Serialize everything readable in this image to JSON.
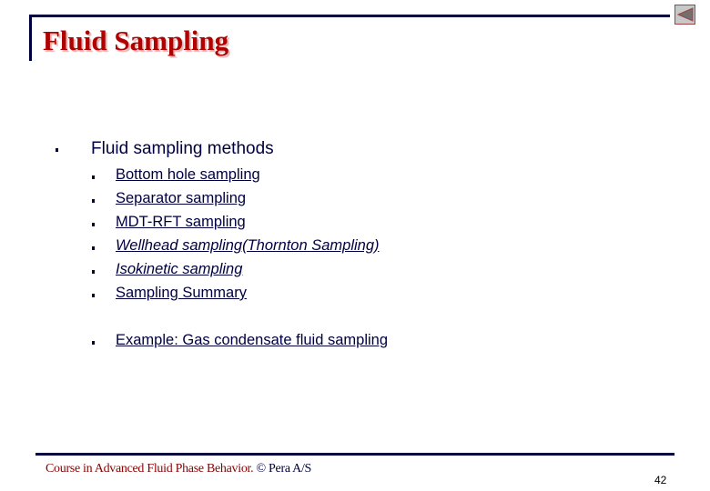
{
  "slide": {
    "title": "Fluid Sampling",
    "back_button_label": "previous-slide",
    "main_bullet": "Fluid sampling methods",
    "sub_items": [
      {
        "label": "Bottom hole sampling",
        "italic": false
      },
      {
        "label": "Separator sampling",
        "italic": false
      },
      {
        "label": "MDT-RFT sampling",
        "italic": false
      },
      {
        "label": "Wellhead sampling(Thornton Sampling)",
        "italic": true
      },
      {
        "label": "Isokinetic sampling",
        "italic": true
      },
      {
        "label": "Sampling Summary",
        "italic": false
      }
    ],
    "example_item": {
      "label": "Example: Gas condensate fluid sampling",
      "italic": false
    },
    "footer": {
      "course": "Course in Advanced Fluid Phase Behavior.",
      "copyright": "© Pera A/S"
    },
    "page_number": "42",
    "colors": {
      "title": "#b00000",
      "rule": "#000040",
      "text": "#000040",
      "footer_course": "#8b0000"
    }
  }
}
